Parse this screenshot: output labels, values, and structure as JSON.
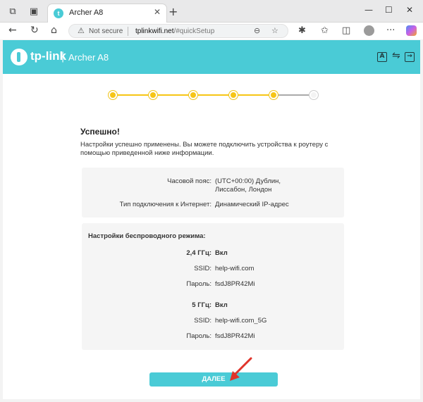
{
  "browser": {
    "tab_title": "Archer A8",
    "tab_close": "✕",
    "new_tab": "+",
    "minimize": "—",
    "maximize": "☐",
    "close": "✕",
    "not_secure": "Not secure",
    "url_host": "tplinkwifi.net",
    "url_path": "/#quickSetup"
  },
  "router": {
    "logo": "tp-link",
    "separator": "|",
    "model": "Archer A8"
  },
  "wizard": {
    "title": "Успешно!",
    "description": "Настройки успешно применены. Вы можете подключить устройства к роутеру с помощью приведенной ниже информации.",
    "timezone_label": "Часовой пояс:",
    "timezone_value": "(UTC+00:00) Дублин, Лиссабон, Лондон",
    "conn_label": "Тип подключения к Интернет:",
    "conn_value": "Динамический IP-адрес",
    "wireless_title": "Настройки беспроводного режима:",
    "band24_label": "2,4 ГГц:",
    "band24_value": "Вкл",
    "ssid24_label": "SSID:",
    "ssid24_value": "help-wifi.com",
    "pass24_label": "Пароль:",
    "pass24_value": "fsdJ8PR42Mi",
    "band5_label": "5 ГГц:",
    "band5_value": "Вкл",
    "ssid5_label": "SSID:",
    "ssid5_value": "help-wifi.com_5G",
    "pass5_label": "Пароль:",
    "pass5_value": "fsdJ8PR42Mi",
    "next_button": "ДАЛЕЕ"
  },
  "colors": {
    "brand": "#4acbd6",
    "step_active": "#f6c516",
    "arrow": "#e0342b"
  }
}
